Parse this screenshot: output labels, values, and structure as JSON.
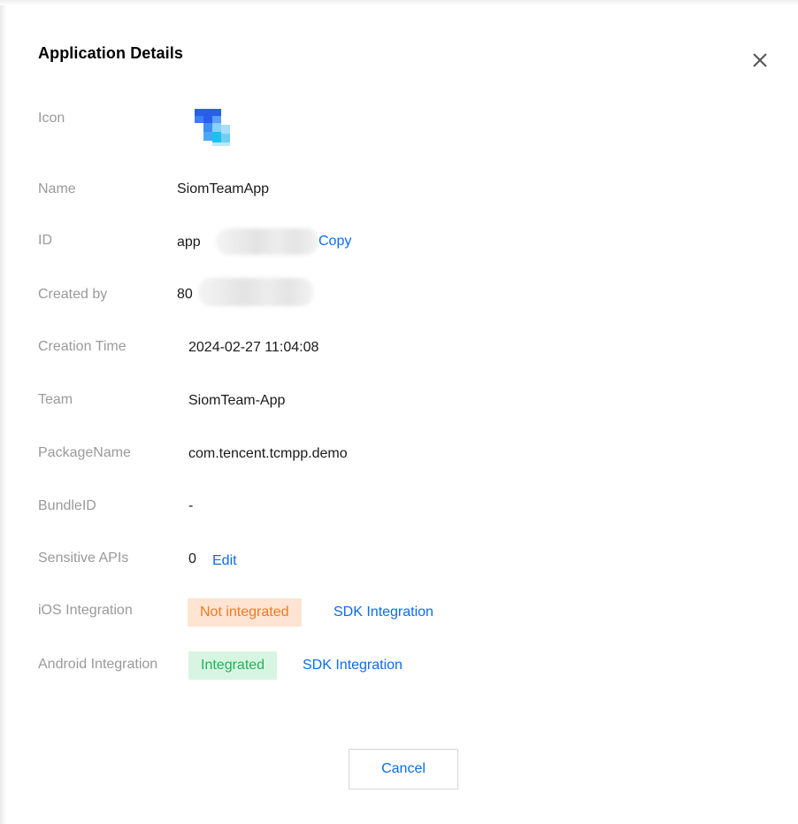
{
  "dialog": {
    "title": "Application Details",
    "cancel_label": "Cancel"
  },
  "fields": {
    "icon": {
      "label": "Icon"
    },
    "name": {
      "label": "Name",
      "value": "SiomTeamApp"
    },
    "id": {
      "label": "ID",
      "value_prefix": "app",
      "copy_label": "Copy"
    },
    "created_by": {
      "label": "Created by",
      "value_prefix": "80"
    },
    "creation_time": {
      "label": "Creation Time",
      "value": "2024-02-27 11:04:08"
    },
    "team": {
      "label": "Team",
      "value": "SiomTeam-App"
    },
    "package_name": {
      "label": "PackageName",
      "value": "com.tencent.tcmpp.demo"
    },
    "bundle_id": {
      "label": "BundleID",
      "value": "-"
    },
    "sensitive_apis": {
      "label": "Sensitive APIs",
      "value": "0",
      "edit_label": "Edit"
    },
    "ios_integration": {
      "label": "iOS Integration",
      "status": "Not integrated",
      "link_label": "SDK Integration"
    },
    "android_integration": {
      "label": "Android Integration",
      "status": "Integrated",
      "link_label": "SDK Integration"
    }
  },
  "colors": {
    "link": "#0a6cf0",
    "label": "#9a9a9a",
    "warn_bg": "#ffe4d3",
    "warn_text": "#f07a1f",
    "ok_bg": "#d8f5e2",
    "ok_text": "#1fb35c"
  }
}
